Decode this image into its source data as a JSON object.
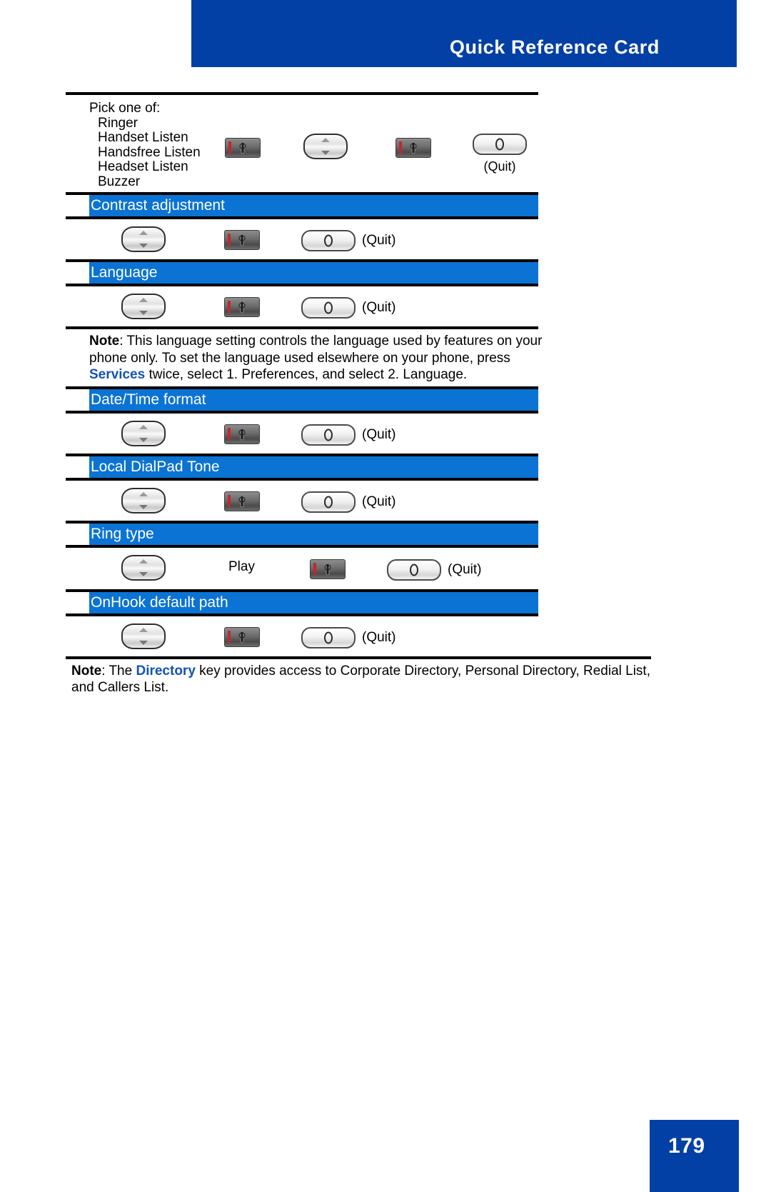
{
  "header": {
    "title": "Quick Reference Card",
    "background_color": "#0340a6"
  },
  "colors": {
    "brand_blue": "#0340a6",
    "band_blue": "#0b73d4",
    "keyword_blue": "#1053b8",
    "rule_black": "#000000"
  },
  "pick_block": {
    "lead": "Pick one of:",
    "options": [
      "Ringer",
      "Handset Listen",
      "Handsfree Listen",
      "Headset Listen",
      "Buzzer"
    ],
    "icons": [
      {
        "name": "select-key",
        "caption": ""
      },
      {
        "name": "navigation-key",
        "caption": ""
      },
      {
        "name": "select-key",
        "caption": ""
      },
      {
        "name": "quit-key",
        "caption": "(Quit)"
      }
    ]
  },
  "sections": [
    {
      "title": "Contrast adjustment",
      "steps": [
        {
          "icon": "navigation-key",
          "label": ""
        },
        {
          "icon": "select-key",
          "label": ""
        },
        {
          "icon": "quit-key",
          "label": "(Quit)"
        }
      ]
    },
    {
      "title": "Language",
      "steps": [
        {
          "icon": "navigation-key",
          "label": ""
        },
        {
          "icon": "select-key",
          "label": ""
        },
        {
          "icon": "quit-key",
          "label": "(Quit)"
        }
      ]
    },
    {
      "title": "Date/Time format",
      "steps": [
        {
          "icon": "navigation-key",
          "label": ""
        },
        {
          "icon": "select-key",
          "label": ""
        },
        {
          "icon": "quit-key",
          "label": "(Quit)"
        }
      ]
    },
    {
      "title": "Local DialPad Tone",
      "steps": [
        {
          "icon": "navigation-key",
          "label": ""
        },
        {
          "icon": "select-key",
          "label": ""
        },
        {
          "icon": "quit-key",
          "label": "(Quit)"
        }
      ]
    },
    {
      "title": "Ring type",
      "steps": [
        {
          "icon": "navigation-key",
          "label": ""
        },
        {
          "icon": "text",
          "label": "Play"
        },
        {
          "icon": "select-key",
          "label": ""
        },
        {
          "icon": "quit-key",
          "label": "(Quit)"
        }
      ]
    },
    {
      "title": "OnHook default path",
      "steps": [
        {
          "icon": "navigation-key",
          "label": ""
        },
        {
          "icon": "select-key",
          "label": ""
        },
        {
          "icon": "quit-key",
          "label": "(Quit)"
        }
      ]
    }
  ],
  "language_note": {
    "label": "Note",
    "part1": ": This language setting controls the language used by features on your phone only. To set the language used elsewhere on your phone, press ",
    "keyword": "Services",
    "part2": " twice, select 1. Preferences, and select 2. Language."
  },
  "directory_note": {
    "label": "Note",
    "part1": ": The ",
    "keyword": "Directory",
    "part2": " key provides access to Corporate Directory, Personal Directory, Redial List, and Callers List."
  },
  "footer": {
    "page_number": "179"
  }
}
